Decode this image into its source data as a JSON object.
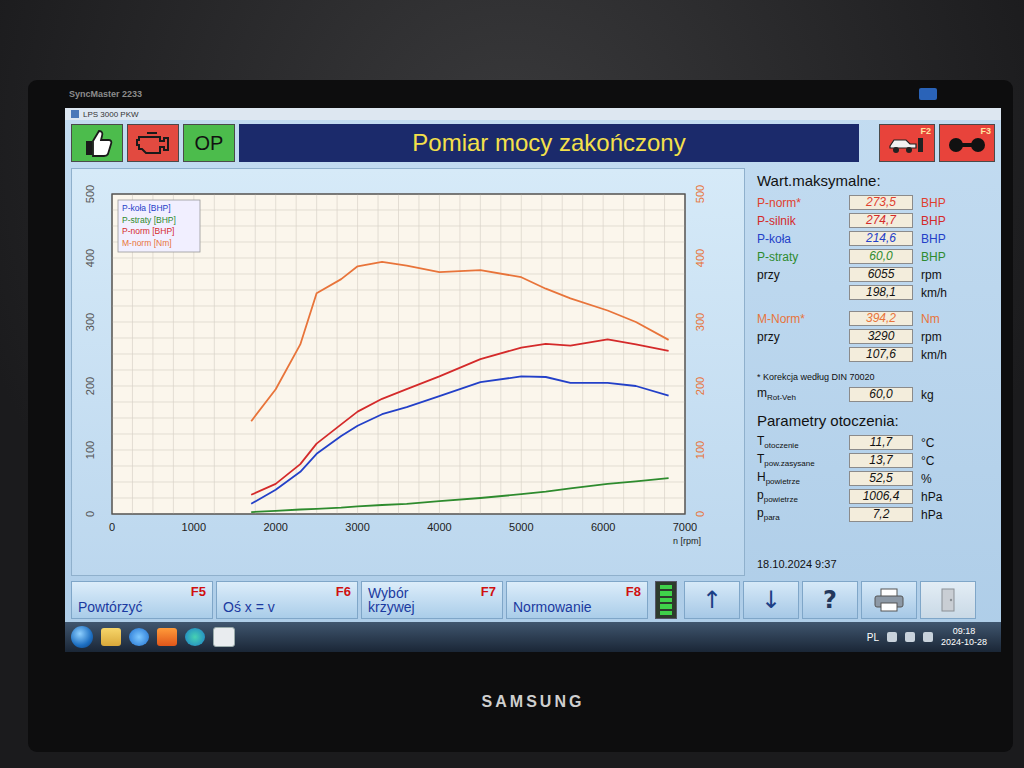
{
  "window": {
    "title": "LPS 3000 PKW"
  },
  "monitor": {
    "model": "SyncMaster 2233",
    "brand": "SAMSUNG"
  },
  "toolbar": {
    "left_buttons": [
      {
        "kind": "thumb",
        "label": "",
        "color": "#4cbc4c"
      },
      {
        "kind": "engine",
        "label": "",
        "color": "#e24a40"
      },
      {
        "kind": "text",
        "label": "OP",
        "color": "#4cbc4c"
      }
    ],
    "status": "Pomiar mocy zakończony",
    "function_buttons": [
      {
        "kind": "car",
        "key": "F2"
      },
      {
        "kind": "wheels",
        "key": "F3"
      }
    ]
  },
  "chart": {
    "y_left_ticks": [
      "0",
      "100",
      "200",
      "300",
      "400",
      "500"
    ],
    "y_right_ticks": [
      "0",
      "100",
      "200",
      "300",
      "400",
      "500"
    ],
    "x_ticks": [
      "0",
      "1000",
      "2000",
      "3000",
      "4000",
      "5000",
      "6000",
      "7000"
    ],
    "x_label": "n [rpm]",
    "rpm": [
      1700,
      2000,
      2300,
      2500,
      2800,
      3000,
      3300,
      3600,
      4000,
      4500,
      5000,
      5300,
      5600,
      6055,
      6400,
      6800
    ],
    "series": [
      {
        "name": "P-koła [BHP]",
        "color": "#2340c8",
        "values": [
          16,
          38,
          66,
          94,
          122,
          138,
          156,
          167,
          184,
          206,
          215,
          214,
          205,
          205,
          200,
          185
        ]
      },
      {
        "name": "P-straty [BHP]",
        "color": "#2e8b2e",
        "values": [
          3,
          5,
          7,
          8,
          10,
          12,
          14,
          16,
          20,
          25,
          31,
          35,
          40,
          47,
          51,
          56
        ]
      },
      {
        "name": "P-norm [BHP]",
        "color": "#d42a2a",
        "values": [
          30,
          47,
          78,
          110,
          140,
          160,
          180,
          195,
          215,
          242,
          260,
          266,
          263,
          273,
          265,
          255
        ]
      },
      {
        "name": "M-norm [Nm]",
        "color": "#e8743a",
        "values": [
          145,
          195,
          265,
          345,
          367,
          387,
          394,
          388,
          378,
          381,
          370,
          352,
          337,
          318,
          300,
          272
        ]
      }
    ]
  },
  "maxima": {
    "title": "Wart.maksymalne:",
    "groups": [
      [
        {
          "label": "P-norm*",
          "value": "273,5",
          "unit": "BHP",
          "color": "#e0402e"
        },
        {
          "label": "P-silnik",
          "value": "274,7",
          "unit": "BHP",
          "color": "#d42a2a"
        },
        {
          "label": "P-koła",
          "value": "214,6",
          "unit": "BHP",
          "color": "#2340c8"
        },
        {
          "label": "P-straty",
          "value": "60,0",
          "unit": "BHP",
          "color": "#2e8b2e"
        },
        {
          "label": "przy",
          "value": "6055",
          "unit": "rpm",
          "color": "#111111"
        },
        {
          "label": "",
          "value": "198,1",
          "unit": "km/h",
          "color": "#111111"
        }
      ],
      [
        {
          "label": "M-Norm*",
          "value": "394,2",
          "unit": "Nm",
          "color": "#e8743a"
        },
        {
          "label": "przy",
          "value": "3290",
          "unit": "rpm",
          "color": "#111111"
        },
        {
          "label": "",
          "value": "107,6",
          "unit": "km/h",
          "color": "#111111"
        }
      ]
    ],
    "note": "* Korekcja według DIN 70020",
    "rot": {
      "label": "m",
      "sub": "Rot-Veh",
      "value": "60,0",
      "unit": "kg"
    }
  },
  "environment": {
    "title": "Parametry otoczenia:",
    "rows": [
      {
        "label": "T",
        "sub": "otoczenie",
        "value": "11,7",
        "unit": "°C"
      },
      {
        "label": "T",
        "sub": "pow.zasysane",
        "value": "13,7",
        "unit": "°C"
      },
      {
        "label": "H",
        "sub": "powietrze",
        "value": "52,5",
        "unit": "%"
      },
      {
        "label": "p",
        "sub": "powietrze",
        "value": "1006,4",
        "unit": "hPa"
      },
      {
        "label": "p",
        "sub": "para",
        "value": "7,2",
        "unit": "hPa"
      }
    ]
  },
  "timestamp": "18.10.2024 9:37",
  "fkeys": [
    {
      "label": "Powtórzyć",
      "key": "F5"
    },
    {
      "label": "Oś x = v",
      "key": "F6"
    },
    {
      "label": "Wybór krzywej",
      "key": "F7"
    },
    {
      "label": "Normowanie",
      "key": "F8"
    }
  ],
  "meter": {
    "level": 1
  },
  "tools": [
    {
      "kind": "up",
      "label": "↑",
      "disabled": false
    },
    {
      "kind": "down",
      "label": "↓",
      "disabled": false
    },
    {
      "kind": "help",
      "label": "?",
      "disabled": false
    },
    {
      "kind": "print",
      "label": "",
      "disabled": false
    },
    {
      "kind": "exit",
      "label": "",
      "disabled": true
    }
  ],
  "taskbar": {
    "apps": [
      {
        "kind": "explorer"
      },
      {
        "kind": "ie"
      },
      {
        "kind": "media"
      },
      {
        "kind": "edge"
      },
      {
        "kind": "app"
      }
    ],
    "tray": {
      "lang": "PL",
      "time": "09:18",
      "date": "2024-10-28"
    }
  }
}
